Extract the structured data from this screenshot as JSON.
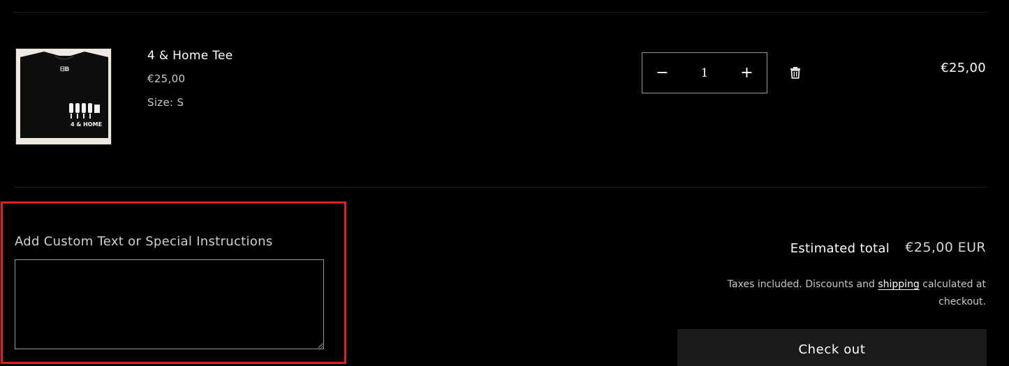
{
  "cart_item": {
    "name": "4 & Home Tee",
    "price": "€25,00",
    "size_label": "Size:",
    "size_value": "S",
    "image_alt": "Black 4 & Home T-shirt",
    "image_logo_text": "4 & HOME",
    "quantity": "1",
    "line_total": "€25,00",
    "decrease_symbol": "−",
    "increase_symbol": "+",
    "remove_icon": "trash-icon"
  },
  "cart_note": {
    "label": "Add Custom Text or Special Instructions",
    "value": "",
    "highlight_color": "#e0201f"
  },
  "summary": {
    "estimated_total_label": "Estimated total",
    "estimated_total_value": "€25,00 EUR",
    "tax_note_before": "Taxes included. Discounts and",
    "tax_note_link": "shipping",
    "tax_note_after": "calculated at checkout.",
    "checkout_label": "Check out"
  },
  "colors": {
    "background": "#000000",
    "divider": "#1f1f1f",
    "border": "#9a9a9a",
    "checkout_bg": "#1a1a1a"
  }
}
